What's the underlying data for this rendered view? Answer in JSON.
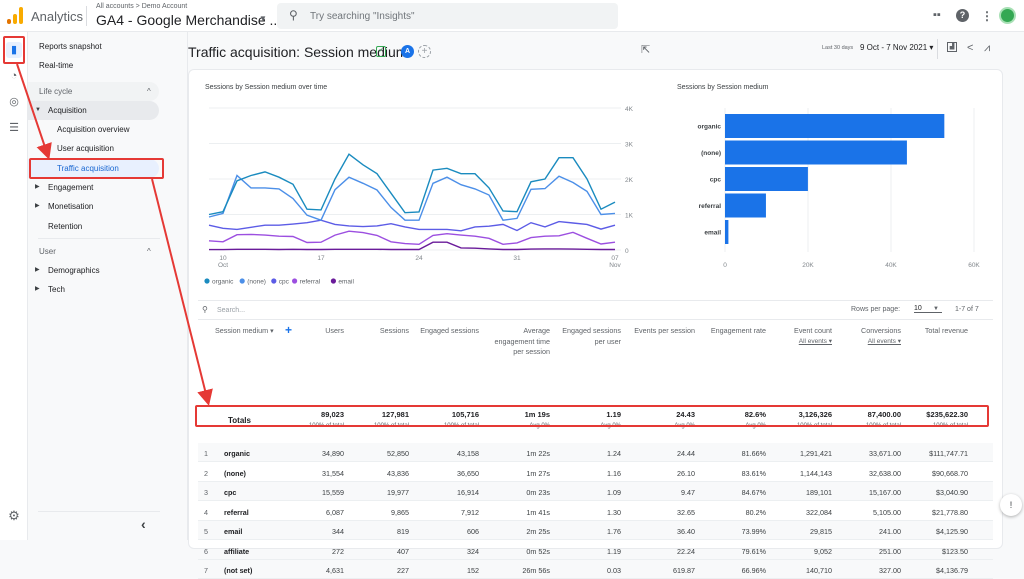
{
  "app": {
    "name": "Analytics",
    "breadcrumb": "All accounts > Demo Account",
    "property": "GA4 - Google Merchandise ...",
    "search_placeholder": "Try searching \"Insights\"",
    "logo_colors": [
      "#f9ab00",
      "#e37400",
      "#e37400"
    ]
  },
  "top_icons": [
    "apps-grid-icon",
    "help-icon",
    "more-vert-icon",
    "account-avatar"
  ],
  "rail": {
    "items": [
      {
        "name": "reports-icon",
        "glyph": "▮",
        "active": true
      },
      {
        "name": "explore-icon",
        "glyph": "◔",
        "active": false
      },
      {
        "name": "advertising-icon",
        "glyph": "◎",
        "active": false
      },
      {
        "name": "configure-icon",
        "glyph": "☰",
        "active": false
      }
    ],
    "settings_glyph": "⚙"
  },
  "sidenav": {
    "reports_snapshot": "Reports snapshot",
    "realtime": "Real-time",
    "lifecycle_header": "Life cycle",
    "acquisition": "Acquisition",
    "acquisition_overview": "Acquisition overview",
    "user_acquisition": "User acquisition",
    "traffic_acquisition": "Traffic acquisition",
    "engagement": "Engagement",
    "monetisation": "Monetisation",
    "retention": "Retention",
    "user_header": "User",
    "demographics": "Demographics",
    "tech": "Tech",
    "collapse_glyph": "‹"
  },
  "header": {
    "title": "Traffic acquisition: Session medium",
    "compare_badge": "A",
    "date_label": "Last 30 days",
    "date_range": "9 Oct - 7 Nov 2021 ▾"
  },
  "line_chart_title": "Sessions by Session medium over time",
  "bar_chart_title": "Sessions by Session medium",
  "chart_data": [
    {
      "type": "line",
      "title": "Sessions by Session medium over time",
      "x_ticks": [
        {
          "day": 1,
          "label": "10",
          "sub": "Oct"
        },
        {
          "day": 8,
          "label": "17",
          "sub": ""
        },
        {
          "day": 15,
          "label": "24",
          "sub": ""
        },
        {
          "day": 22,
          "label": "31",
          "sub": ""
        },
        {
          "day": 29,
          "label": "07",
          "sub": "Nov"
        }
      ],
      "y_ticks": [
        {
          "value": 0,
          "label": "0"
        },
        {
          "value": 1000,
          "label": "1K"
        },
        {
          "value": 2000,
          "label": "2K"
        },
        {
          "value": 3000,
          "label": "3K"
        },
        {
          "value": 4000,
          "label": "4K"
        }
      ],
      "ylim": [
        0,
        4000
      ],
      "x_start_date": "9 Oct",
      "series": [
        {
          "name": "organic",
          "color": "#1a8bbf",
          "values": [
            1000,
            1080,
            1950,
            2100,
            2200,
            2050,
            1850,
            1150,
            1130,
            2000,
            2700,
            2400,
            2150,
            1600,
            1050,
            1070,
            2250,
            2300,
            2150,
            2150,
            1750,
            1100,
            1080,
            1920,
            2000,
            2600,
            2600,
            2000,
            1150,
            1350
          ]
        },
        {
          "name": "(none)",
          "color": "#4c8fe8",
          "values": [
            930,
            1030,
            2100,
            1750,
            1750,
            1720,
            1450,
            980,
            840,
            1700,
            2050,
            1880,
            1690,
            1200,
            840,
            840,
            1880,
            2050,
            1840,
            1720,
            1550,
            840,
            890,
            1710,
            1730,
            2080,
            1900,
            1650,
            1000,
            1030
          ]
        },
        {
          "name": "cpc",
          "color": "#5c5ce6",
          "values": [
            700,
            610,
            580,
            640,
            700,
            700,
            730,
            770,
            840,
            720,
            680,
            660,
            680,
            740,
            650,
            580,
            580,
            580,
            540,
            650,
            670,
            720,
            550,
            770,
            650,
            800,
            760,
            720,
            590,
            700
          ]
        },
        {
          "name": "referral",
          "color": "#9c4fe0",
          "values": [
            260,
            230,
            430,
            440,
            420,
            390,
            380,
            210,
            220,
            420,
            530,
            490,
            410,
            230,
            180,
            160,
            410,
            460,
            420,
            390,
            330,
            160,
            200,
            350,
            390,
            400,
            500,
            330,
            170,
            220
          ]
        },
        {
          "name": "email",
          "color": "#6a1b9a",
          "values": [
            10,
            10,
            20,
            20,
            20,
            15,
            20,
            15,
            15,
            20,
            20,
            20,
            20,
            15,
            15,
            15,
            220,
            220,
            60,
            50,
            30,
            15,
            15,
            25,
            30,
            30,
            25,
            20,
            15,
            15
          ]
        }
      ],
      "legend": "bottom-left",
      "grid": true
    },
    {
      "type": "bar",
      "orientation": "horizontal",
      "title": "Sessions by Session medium",
      "categories": [
        "organic",
        "(none)",
        "cpc",
        "referral",
        "email"
      ],
      "values": [
        52850,
        43836,
        19977,
        9865,
        819
      ],
      "x_ticks": [
        {
          "value": 0,
          "label": "0"
        },
        {
          "value": 20000,
          "label": "20K"
        },
        {
          "value": 40000,
          "label": "40K"
        },
        {
          "value": 60000,
          "label": "60K"
        }
      ],
      "xlim": [
        0,
        60000
      ],
      "color": "#1a73e8",
      "grid": true
    }
  ],
  "table": {
    "search_placeholder": "Search...",
    "rows_per_page_label": "Rows per page:",
    "rows_per_page": "10",
    "pagination": "1-7 of 7",
    "dimension_header": "Session medium ▾",
    "columns": [
      {
        "key": "users",
        "label": "Users"
      },
      {
        "key": "sessions",
        "label": "Sessions"
      },
      {
        "key": "engaged_sessions",
        "label": "Engaged sessions"
      },
      {
        "key": "avg_engagement_time",
        "label": "Average engagement time per session"
      },
      {
        "key": "engaged_per_user",
        "label": "Engaged sessions per user"
      },
      {
        "key": "events_per_session",
        "label": "Events per session"
      },
      {
        "key": "engagement_rate",
        "label": "Engagement rate"
      },
      {
        "key": "event_count",
        "label": "Event count",
        "sub": "All events ▾"
      },
      {
        "key": "conversions",
        "label": "Conversions",
        "sub": "All events ▾"
      },
      {
        "key": "total_revenue",
        "label": "Total revenue"
      }
    ],
    "totals": {
      "label": "Totals",
      "values": [
        "89,023",
        "127,981",
        "105,716",
        "1m 19s",
        "1.19",
        "24.43",
        "82.6%",
        "3,126,326",
        "87,400.00",
        "$235,622.30"
      ],
      "subs": [
        "100% of total",
        "100% of total",
        "100% of total",
        "Avg 0%",
        "Avg 0%",
        "Avg 0%",
        "Avg 0%",
        "100% of total",
        "100% of total",
        "100% of total"
      ]
    },
    "rows": [
      {
        "idx": "1",
        "medium": "organic",
        "values": [
          "34,890",
          "52,850",
          "43,158",
          "1m 22s",
          "1.24",
          "24.44",
          "81.66%",
          "1,291,421",
          "33,671.00",
          "$111,747.71"
        ]
      },
      {
        "idx": "2",
        "medium": "(none)",
        "values": [
          "31,554",
          "43,836",
          "36,650",
          "1m 27s",
          "1.16",
          "26.10",
          "83.61%",
          "1,144,143",
          "32,638.00",
          "$90,668.70"
        ]
      },
      {
        "idx": "3",
        "medium": "cpc",
        "values": [
          "15,559",
          "19,977",
          "16,914",
          "0m 23s",
          "1.09",
          "9.47",
          "84.67%",
          "189,101",
          "15,167.00",
          "$3,040.90"
        ]
      },
      {
        "idx": "4",
        "medium": "referral",
        "values": [
          "6,087",
          "9,865",
          "7,912",
          "1m 41s",
          "1.30",
          "32.65",
          "80.2%",
          "322,084",
          "5,105.00",
          "$21,778.80"
        ]
      },
      {
        "idx": "5",
        "medium": "email",
        "values": [
          "344",
          "819",
          "606",
          "2m 25s",
          "1.76",
          "36.40",
          "73.99%",
          "29,815",
          "241.00",
          "$4,125.90"
        ]
      },
      {
        "idx": "6",
        "medium": "affiliate",
        "values": [
          "272",
          "407",
          "324",
          "0m 52s",
          "1.19",
          "22.24",
          "79.61%",
          "9,052",
          "251.00",
          "$123.50"
        ]
      },
      {
        "idx": "7",
        "medium": "(not set)",
        "values": [
          "4,631",
          "227",
          "152",
          "26m 56s",
          "0.03",
          "619.87",
          "66.96%",
          "140,710",
          "327.00",
          "$4,136.79"
        ]
      }
    ]
  },
  "annotation_color": "#e53935"
}
